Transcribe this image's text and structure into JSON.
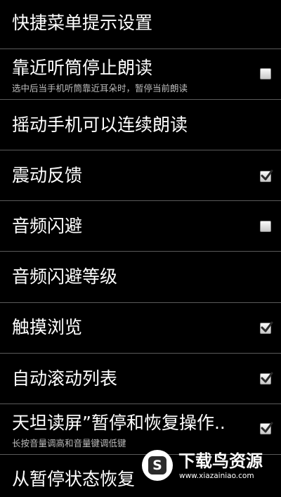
{
  "settings": [
    {
      "title": "快捷菜单提示设置",
      "summary": "",
      "checkbox": null
    },
    {
      "title": "靠近听筒停止朗读",
      "summary": "选中后当手机听筒靠近耳朵时，暂停当前朗读",
      "checkbox": false
    },
    {
      "title": "摇动手机可以连续朗读",
      "summary": "",
      "checkbox": null
    },
    {
      "title": "震动反馈",
      "summary": "",
      "checkbox": true
    },
    {
      "title": "音频闪避",
      "summary": "",
      "checkbox": false
    },
    {
      "title": "音频闪避等级",
      "summary": "",
      "checkbox": null
    },
    {
      "title": "触摸浏览",
      "summary": "",
      "checkbox": true
    },
    {
      "title": "自动滚动列表",
      "summary": "",
      "checkbox": true
    },
    {
      "title": "天坦读屏”暂停和恢复操作..",
      "summary": "长按音量调高和音量键调低键",
      "checkbox": true
    },
    {
      "title": "从暂停状态恢复",
      "summary": "",
      "checkbox": null
    }
  ],
  "watermark": {
    "badge": "S",
    "title": "下载鸟资源",
    "url": "www.xiazainiao.com"
  }
}
